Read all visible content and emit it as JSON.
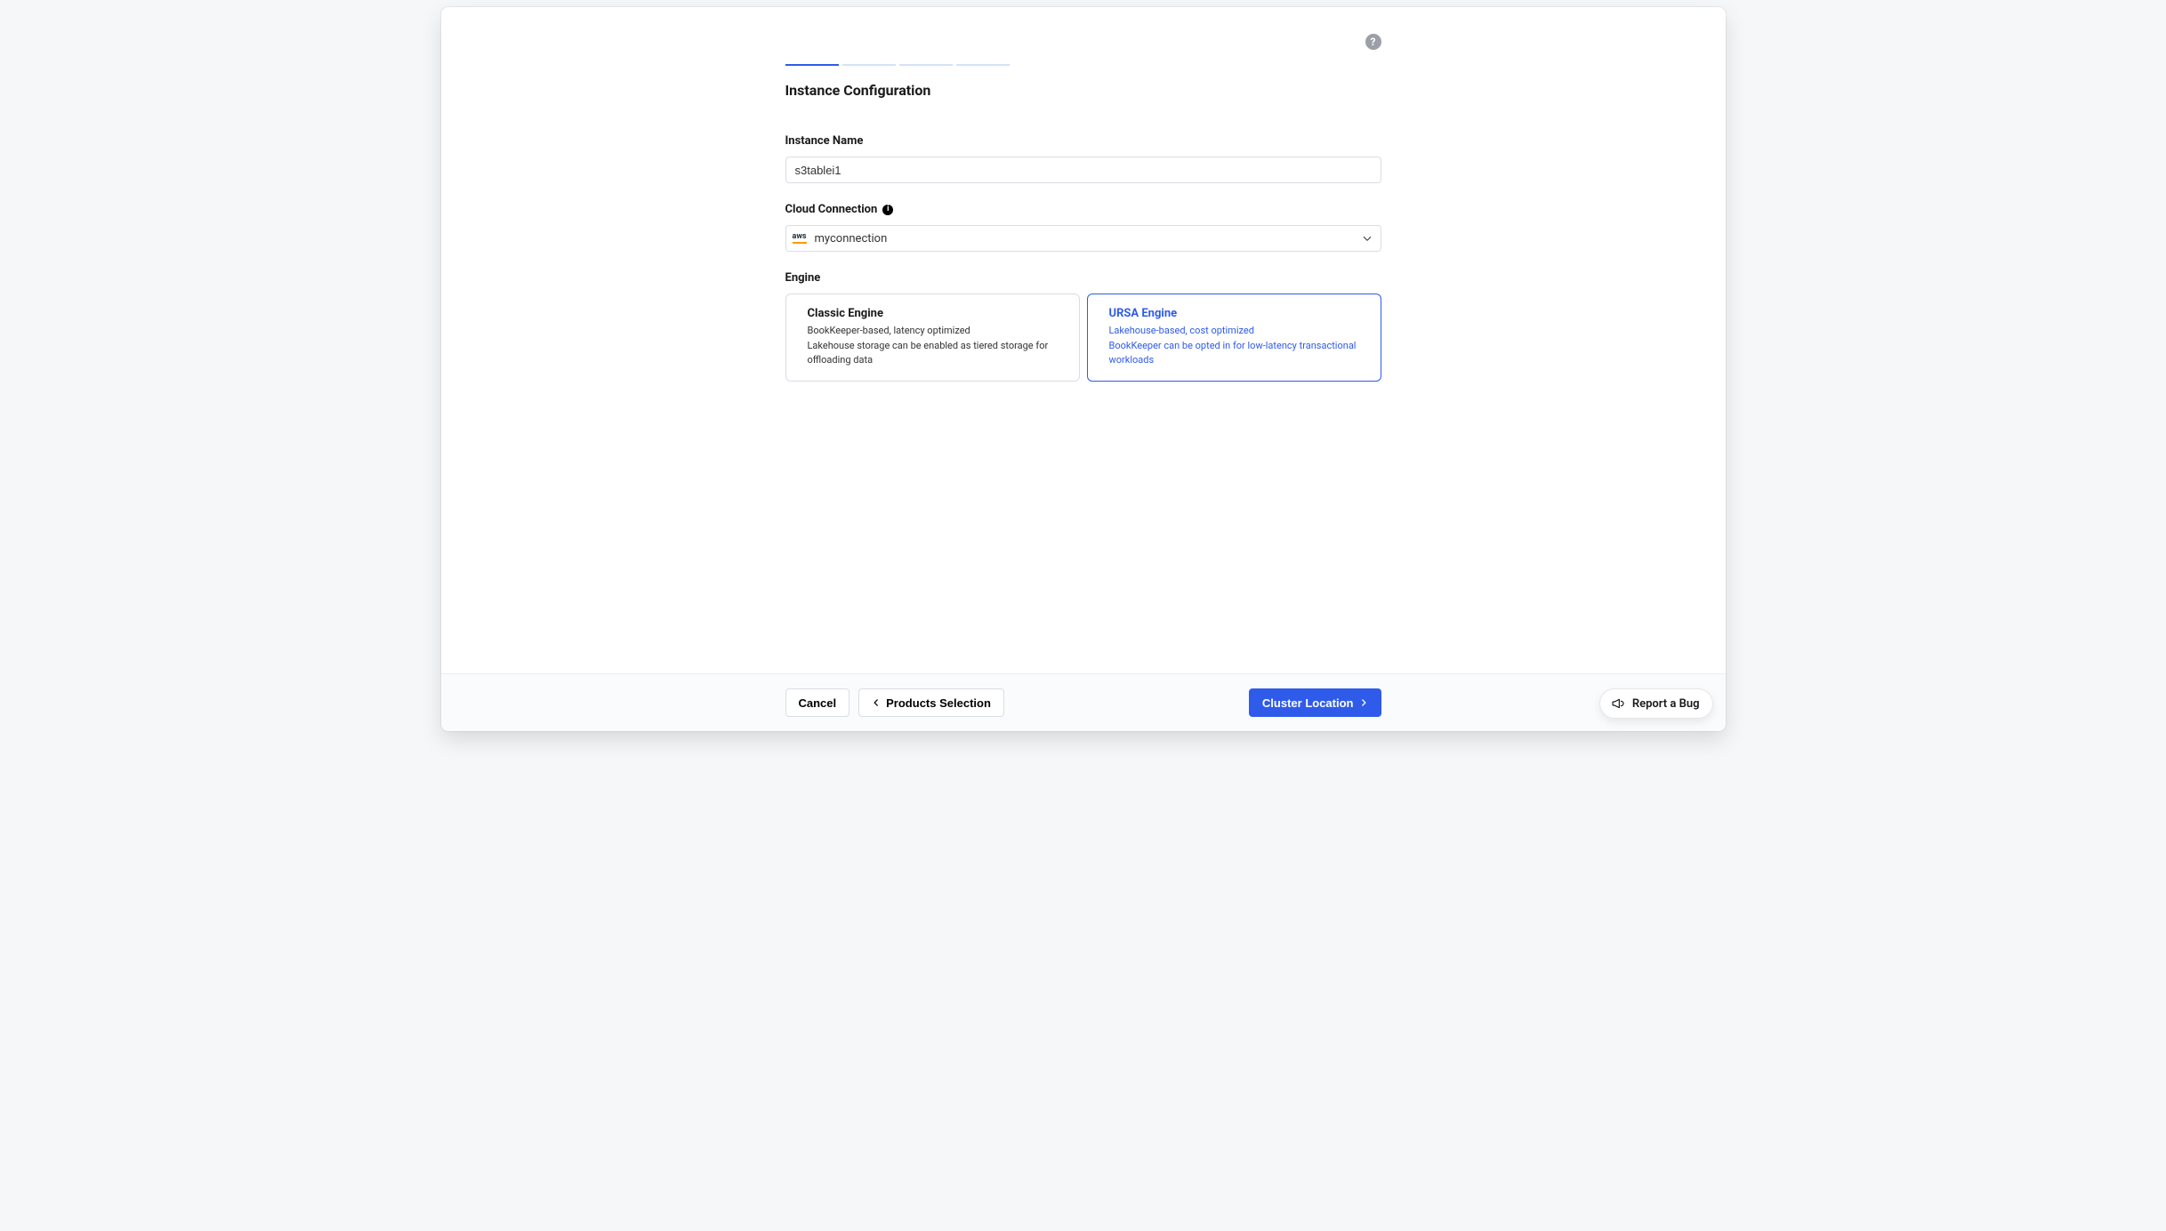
{
  "help_glyph": "?",
  "stepper": {
    "total": 4,
    "active": 0
  },
  "section_title": "Instance Configuration",
  "instance_name": {
    "label": "Instance Name",
    "value": "s3tablei1"
  },
  "cloud_connection": {
    "label": "Cloud Connection",
    "provider_badge": "aws",
    "selected": "myconnection"
  },
  "engine": {
    "label": "Engine",
    "options": [
      {
        "id": "classic",
        "title": "Classic Engine",
        "line1": "BookKeeper-based, latency optimized",
        "line2": "Lakehouse storage can be enabled as tiered storage for offloading data",
        "selected": false
      },
      {
        "id": "ursa",
        "title": "URSA Engine",
        "line1": "Lakehouse-based, cost optimized",
        "line2": "BookKeeper can be opted in for low-latency transactional workloads",
        "selected": true
      }
    ]
  },
  "footer": {
    "cancel": "Cancel",
    "back": "Products Selection",
    "next": "Cluster Location"
  },
  "report_bug": "Report a Bug"
}
